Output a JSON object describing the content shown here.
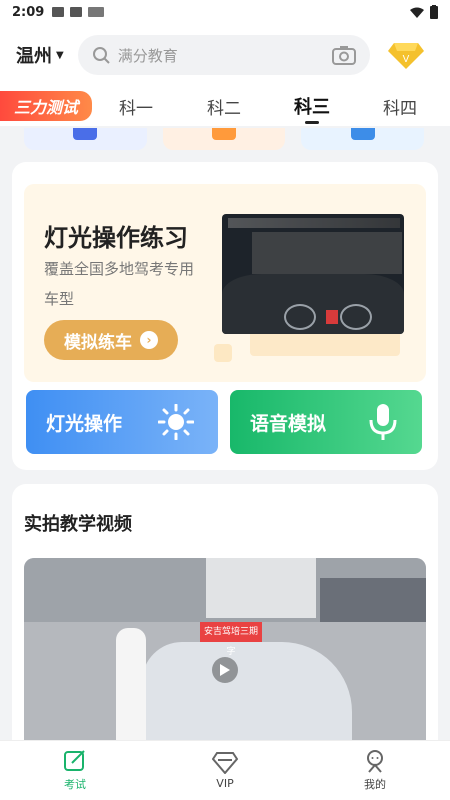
{
  "status_bar": {
    "time": "2:09"
  },
  "header": {
    "city": "温州",
    "search_placeholder": "满分教育"
  },
  "tabs": {
    "logo": "三力测试",
    "items": [
      "科一",
      "科二",
      "科三",
      "科四"
    ],
    "active_index": 2
  },
  "practice": {
    "title": "灯光操作练习",
    "subtitle": "覆盖全国多地驾考专用车型",
    "button": "模拟练车"
  },
  "actions": {
    "light": "灯光操作",
    "voice": "语音模拟"
  },
  "videos": {
    "title": "实拍教学视频",
    "sign": "安吉驾培三期字"
  },
  "bottom_nav": [
    {
      "label": "考试"
    },
    {
      "label": "VIP"
    },
    {
      "label": "我的"
    }
  ],
  "colors": {
    "accent_green": "#19b36b",
    "practice_bg": "#fff7e8",
    "button_gold": "#e6ad56",
    "light_blue": "#3f8ff3",
    "voice_green": "#18b86a"
  }
}
